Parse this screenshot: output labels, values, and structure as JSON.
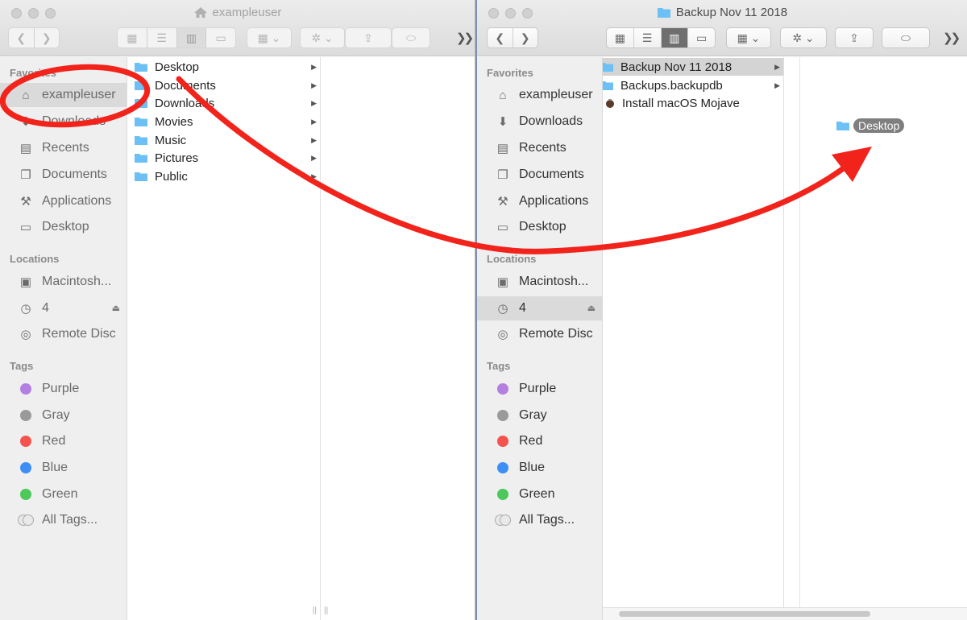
{
  "left_window": {
    "title": "exampleuser",
    "sidebar": {
      "favorites_heading": "Favorites",
      "favorites": [
        {
          "label": "exampleuser",
          "icon": "home-icon",
          "selected": true
        },
        {
          "label": "Downloads",
          "icon": "downloads-icon"
        },
        {
          "label": "Recents",
          "icon": "recents-icon"
        },
        {
          "label": "Documents",
          "icon": "documents-icon"
        },
        {
          "label": "Applications",
          "icon": "applications-icon"
        },
        {
          "label": "Desktop",
          "icon": "desktop-icon"
        }
      ],
      "locations_heading": "Locations",
      "locations": [
        {
          "label": "Macintosh...",
          "icon": "hard-drive-icon"
        },
        {
          "label": "4",
          "icon": "time-machine-icon"
        },
        {
          "label": "Remote Disc",
          "icon": "disc-icon"
        }
      ],
      "tags_heading": "Tags",
      "tags": [
        {
          "label": "Purple",
          "color": "#b37fe0"
        },
        {
          "label": "Gray",
          "color": "#9a9a9a"
        },
        {
          "label": "Red",
          "color": "#f5534e"
        },
        {
          "label": "Blue",
          "color": "#3e8ff5"
        },
        {
          "label": "Green",
          "color": "#4cc95a"
        },
        {
          "label": "All Tags..."
        }
      ]
    },
    "column_items": [
      {
        "label": "Desktop"
      },
      {
        "label": "Documents"
      },
      {
        "label": "Downloads"
      },
      {
        "label": "Movies"
      },
      {
        "label": "Music"
      },
      {
        "label": "Pictures"
      },
      {
        "label": "Public"
      }
    ]
  },
  "right_window": {
    "title": "Backup Nov 11 2018",
    "sidebar": {
      "favorites_heading": "Favorites",
      "favorites": [
        {
          "label": "exampleuser",
          "icon": "home-icon"
        },
        {
          "label": "Downloads",
          "icon": "downloads-icon"
        },
        {
          "label": "Recents",
          "icon": "recents-icon"
        },
        {
          "label": "Documents",
          "icon": "documents-icon"
        },
        {
          "label": "Applications",
          "icon": "applications-icon"
        },
        {
          "label": "Desktop",
          "icon": "desktop-icon"
        }
      ],
      "locations_heading": "Locations",
      "locations": [
        {
          "label": "Macintosh...",
          "icon": "hard-drive-icon"
        },
        {
          "label": "4",
          "icon": "time-machine-icon",
          "selected": true
        },
        {
          "label": "Remote Disc",
          "icon": "disc-icon"
        }
      ],
      "tags_heading": "Tags",
      "tags": [
        {
          "label": "Purple",
          "color": "#b37fe0"
        },
        {
          "label": "Gray",
          "color": "#9a9a9a"
        },
        {
          "label": "Red",
          "color": "#f5534e"
        },
        {
          "label": "Blue",
          "color": "#3e8ff5"
        },
        {
          "label": "Green",
          "color": "#4cc95a"
        },
        {
          "label": "All Tags..."
        }
      ]
    },
    "column_items": [
      {
        "label": "Backup Nov 11 2018",
        "selected": true,
        "has_arrow": true
      },
      {
        "label": "Backups.backupdb",
        "has_arrow": true
      },
      {
        "label": "Install macOS Mojave",
        "icon": "installer-icon"
      }
    ],
    "drag_ghost_label": "Desktop"
  },
  "colors": {
    "folder": "#6cc0f5",
    "annotation_red": "#f2231b"
  }
}
